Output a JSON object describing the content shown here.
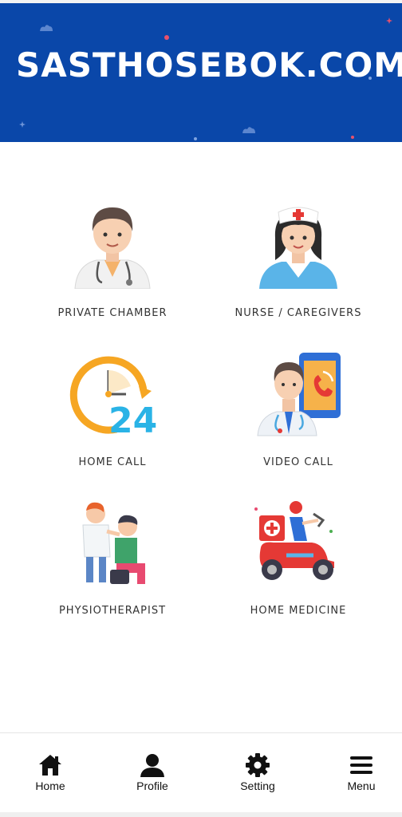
{
  "header": {
    "title": "SASTHOSEBOK.COM",
    "background_color": "#0a47a9"
  },
  "services": [
    {
      "label": "PRIVATE CHAMBER",
      "icon": "doctor-icon"
    },
    {
      "label": "NURSE / CAREGIVERS",
      "icon": "nurse-icon"
    },
    {
      "label": "HOME CALL",
      "icon": "clock-24-icon"
    },
    {
      "label": "VIDEO CALL",
      "icon": "video-call-doctor-icon"
    },
    {
      "label": "PHYSIOTHERAPIST",
      "icon": "physiotherapist-icon"
    },
    {
      "label": "HOME MEDICINE",
      "icon": "delivery-scooter-icon"
    }
  ],
  "bottom_nav": [
    {
      "label": "Home",
      "icon": "home-icon"
    },
    {
      "label": "Profile",
      "icon": "profile-icon"
    },
    {
      "label": "Setting",
      "icon": "gear-icon"
    },
    {
      "label": "Menu",
      "icon": "menu-icon"
    }
  ]
}
